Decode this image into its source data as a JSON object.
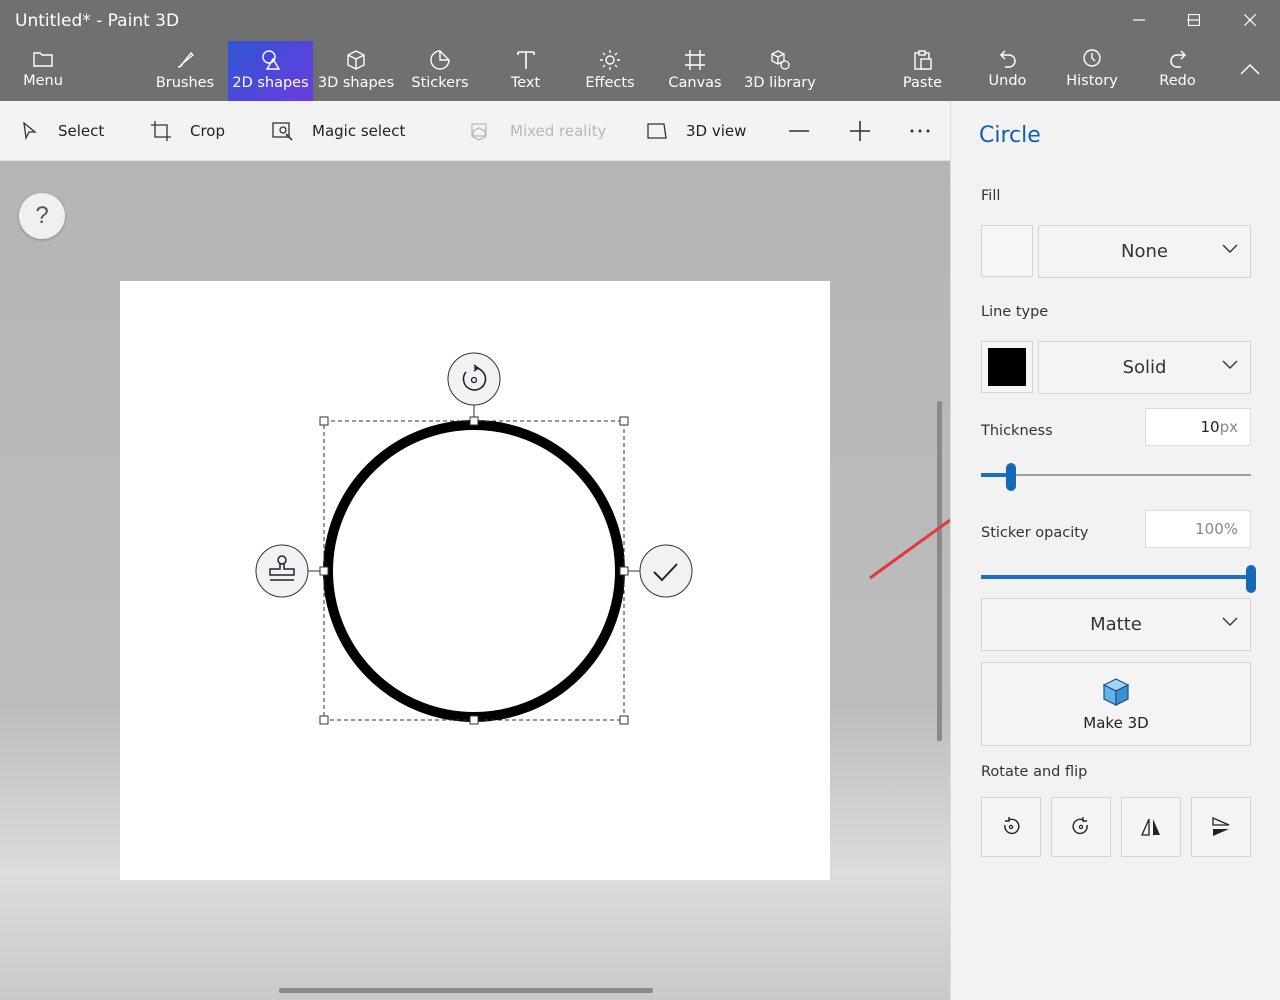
{
  "window": {
    "title": "Untitled* - Paint 3D"
  },
  "ribbon": {
    "menu_label": "Menu",
    "tools": [
      {
        "label": "Brushes",
        "icon": "brush-icon"
      },
      {
        "label": "2D shapes",
        "icon": "2d-shapes-icon",
        "active": true
      },
      {
        "label": "3D shapes",
        "icon": "cube-icon"
      },
      {
        "label": "Stickers",
        "icon": "sticker-icon"
      },
      {
        "label": "Text",
        "icon": "text-icon"
      },
      {
        "label": "Effects",
        "icon": "sun-icon"
      },
      {
        "label": "Canvas",
        "icon": "canvas-icon"
      },
      {
        "label": "3D library",
        "icon": "3d-library-icon"
      }
    ],
    "paste_label": "Paste",
    "undo_label": "Undo",
    "history_label": "History",
    "redo_label": "Redo",
    "accent": "#3a4fd8"
  },
  "toolbar": {
    "select_label": "Select",
    "crop_label": "Crop",
    "magic_select_label": "Magic select",
    "mixed_reality_label": "Mixed reality",
    "view3d_label": "3D view"
  },
  "canvas": {
    "help_label": "?"
  },
  "panel": {
    "title": "Circle",
    "fill_label": "Fill",
    "fill_value": "None",
    "line_type_label": "Line type",
    "line_type_value": "Solid",
    "line_color": "#000000",
    "thickness_label": "Thickness",
    "thickness_value": "10",
    "thickness_unit": "px",
    "thickness_fraction": 0.11,
    "opacity_label": "Sticker opacity",
    "opacity_value": "100%",
    "opacity_fraction": 1.0,
    "finish_value": "Matte",
    "make3d_label": "Make 3D",
    "rotate_flip_label": "Rotate and flip",
    "accent": "#0f5fb4"
  }
}
